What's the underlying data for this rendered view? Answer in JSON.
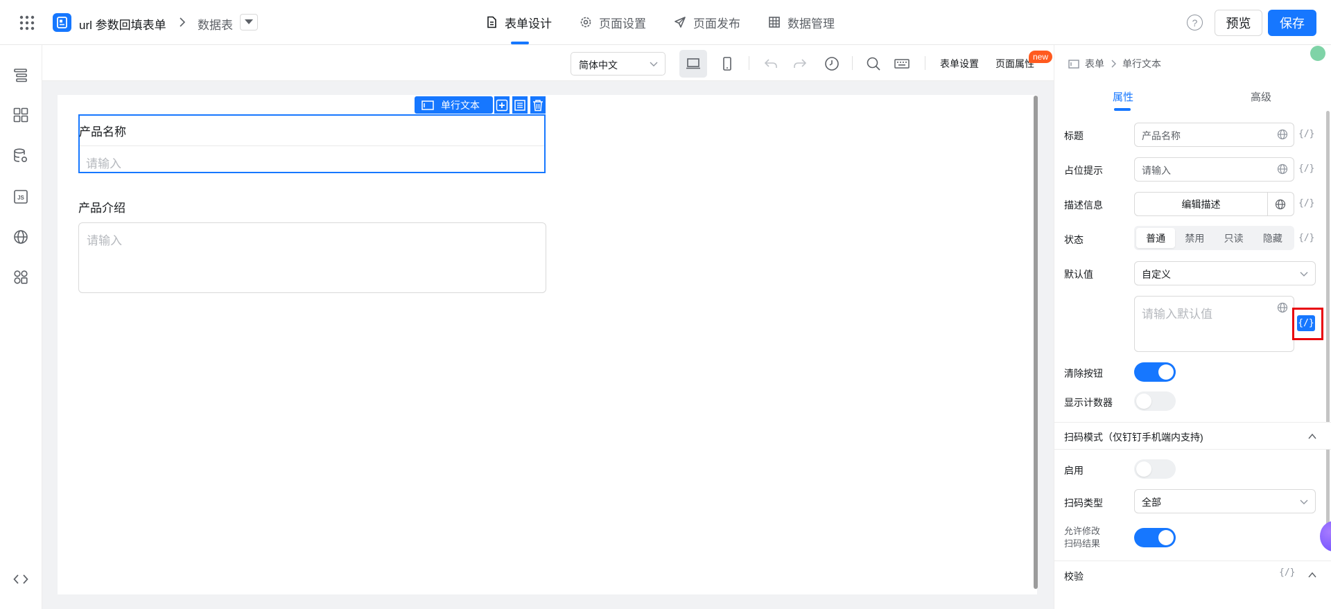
{
  "header": {
    "app_title": "url 参数回填表单",
    "crumb_data": "数据表",
    "tabs": [
      {
        "label": "表单设计",
        "icon": "document-icon"
      },
      {
        "label": "页面设置",
        "icon": "gear-icon"
      },
      {
        "label": "页面发布",
        "icon": "send-icon"
      },
      {
        "label": "数据管理",
        "icon": "table-icon"
      }
    ],
    "help": "?",
    "preview_label": "预览",
    "save_label": "保存"
  },
  "toolbar": {
    "language": "简体中文",
    "form_settings": "表单设置",
    "page_props": "页面属性",
    "new_badge": "new"
  },
  "canvas": {
    "selected_tag": "单行文本",
    "field1_label": "产品名称",
    "field1_placeholder": "请输入",
    "field2_label": "产品介绍",
    "field2_placeholder": "请输入"
  },
  "panel": {
    "crumb": [
      "表单",
      "单行文本"
    ],
    "tabs": [
      "属性",
      "高级"
    ],
    "title_label": "标题",
    "title_value": "产品名称",
    "placeholder_label": "占位提示",
    "placeholder_value": "请输入",
    "desc_label": "描述信息",
    "desc_button": "编辑描述",
    "state_label": "状态",
    "state_options": [
      "普通",
      "禁用",
      "只读",
      "隐藏"
    ],
    "default_label": "默认值",
    "default_mode": "自定义",
    "default_placeholder": "请输入默认值",
    "clear_label": "清除按钮",
    "clear_on": true,
    "counter_label": "显示计数器",
    "counter_on": false,
    "scan_section": "扫码模式（仅钉钉手机端内支持)",
    "scan_enable_label": "启用",
    "scan_enable_on": false,
    "scan_type_label": "扫码类型",
    "scan_type_value": "全部",
    "allow_edit_label_1": "允许修改",
    "allow_edit_label_2": "扫码结果",
    "allow_edit_on": true,
    "validate_section": "校验",
    "code_tag": "{/}"
  },
  "colors": {
    "accent": "#1677ff",
    "highlight": "#e8000b",
    "badge": "#ff5a1f"
  }
}
